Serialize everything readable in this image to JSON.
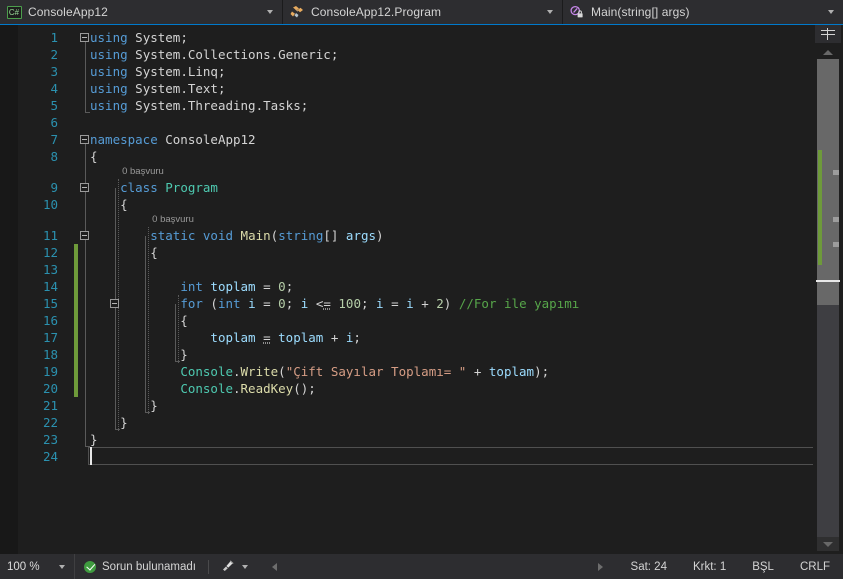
{
  "navbar": {
    "project": {
      "label": "ConsoleApp12",
      "icon": "csharp-file-icon"
    },
    "type": {
      "label": "ConsoleApp12.Program",
      "icon": "class-icon"
    },
    "member": {
      "label": "Main(string[] args)",
      "icon": "method-private-icon"
    },
    "dropdown_icon": "chevron-down-icon"
  },
  "editor": {
    "language": "csharp",
    "codelens_text": "0 başvuru",
    "lines": [
      {
        "n": 1,
        "tokens": [
          {
            "t": "using",
            "c": "kw"
          },
          {
            "t": " ",
            "c": "plain"
          },
          {
            "t": "System",
            "c": "plain"
          },
          {
            "t": ";",
            "c": "plain"
          }
        ]
      },
      {
        "n": 2,
        "tokens": [
          {
            "t": "using",
            "c": "kw"
          },
          {
            "t": " System.Collections.Generic;",
            "c": "plain"
          }
        ]
      },
      {
        "n": 3,
        "tokens": [
          {
            "t": "using",
            "c": "kw"
          },
          {
            "t": " System.Linq;",
            "c": "plain"
          }
        ]
      },
      {
        "n": 4,
        "tokens": [
          {
            "t": "using",
            "c": "kw"
          },
          {
            "t": " System.Text;",
            "c": "plain"
          }
        ]
      },
      {
        "n": 5,
        "tokens": [
          {
            "t": "using",
            "c": "kw"
          },
          {
            "t": " System.Threading.Tasks;",
            "c": "plain"
          }
        ]
      },
      {
        "n": 6,
        "tokens": []
      },
      {
        "n": 7,
        "tokens": [
          {
            "t": "namespace",
            "c": "kw"
          },
          {
            "t": " ConsoleApp12",
            "c": "plain"
          }
        ]
      },
      {
        "n": 8,
        "tokens": [
          {
            "t": "{",
            "c": "plain"
          }
        ]
      },
      {
        "n": 9,
        "tokens": [
          {
            "t": "    ",
            "c": "plain"
          },
          {
            "t": "class",
            "c": "kw"
          },
          {
            "t": " ",
            "c": "plain"
          },
          {
            "t": "Program",
            "c": "type"
          }
        ]
      },
      {
        "n": 10,
        "tokens": [
          {
            "t": "    {",
            "c": "plain"
          }
        ]
      },
      {
        "n": 11,
        "tokens": [
          {
            "t": "        ",
            "c": "plain"
          },
          {
            "t": "static",
            "c": "kw"
          },
          {
            "t": " ",
            "c": "plain"
          },
          {
            "t": "void",
            "c": "kw"
          },
          {
            "t": " ",
            "c": "plain"
          },
          {
            "t": "Main",
            "c": "method"
          },
          {
            "t": "(",
            "c": "plain"
          },
          {
            "t": "string",
            "c": "kw"
          },
          {
            "t": "[] ",
            "c": "plain"
          },
          {
            "t": "args",
            "c": "id"
          },
          {
            "t": ")",
            "c": "plain"
          }
        ]
      },
      {
        "n": 12,
        "tokens": [
          {
            "t": "        {",
            "c": "plain"
          }
        ]
      },
      {
        "n": 13,
        "tokens": []
      },
      {
        "n": 14,
        "tokens": [
          {
            "t": "            ",
            "c": "plain"
          },
          {
            "t": "int",
            "c": "kw"
          },
          {
            "t": " ",
            "c": "plain"
          },
          {
            "t": "toplam",
            "c": "id"
          },
          {
            "t": " = ",
            "c": "plain"
          },
          {
            "t": "0",
            "c": "num"
          },
          {
            "t": ";",
            "c": "plain"
          }
        ]
      },
      {
        "n": 15,
        "tokens": [
          {
            "t": "            ",
            "c": "plain"
          },
          {
            "t": "for",
            "c": "kw"
          },
          {
            "t": " (",
            "c": "plain"
          },
          {
            "t": "int",
            "c": "kw"
          },
          {
            "t": " ",
            "c": "plain"
          },
          {
            "t": "i",
            "c": "id"
          },
          {
            "t": " = ",
            "c": "plain"
          },
          {
            "t": "0",
            "c": "num"
          },
          {
            "t": "; ",
            "c": "plain"
          },
          {
            "t": "i",
            "c": "id"
          },
          {
            "t": " <= ",
            "c": "plain"
          },
          {
            "t": "100",
            "c": "num"
          },
          {
            "t": "; ",
            "c": "plain"
          },
          {
            "t": "i",
            "c": "id"
          },
          {
            "t": " = ",
            "c": "plain"
          },
          {
            "t": "i",
            "c": "id"
          },
          {
            "t": " + ",
            "c": "plain"
          },
          {
            "t": "2",
            "c": "num"
          },
          {
            "t": ") ",
            "c": "plain"
          },
          {
            "t": "//For ile yapımı",
            "c": "cmt"
          }
        ]
      },
      {
        "n": 16,
        "tokens": [
          {
            "t": "            {",
            "c": "plain"
          }
        ]
      },
      {
        "n": 17,
        "tokens": [
          {
            "t": "                ",
            "c": "plain"
          },
          {
            "t": "toplam",
            "c": "id"
          },
          {
            "t": " = ",
            "c": "plain"
          },
          {
            "t": "toplam",
            "c": "id"
          },
          {
            "t": " + ",
            "c": "plain"
          },
          {
            "t": "i",
            "c": "id"
          },
          {
            "t": ";",
            "c": "plain"
          }
        ]
      },
      {
        "n": 18,
        "tokens": [
          {
            "t": "            }",
            "c": "plain"
          }
        ]
      },
      {
        "n": 19,
        "tokens": [
          {
            "t": "            ",
            "c": "plain"
          },
          {
            "t": "Console",
            "c": "type"
          },
          {
            "t": ".",
            "c": "plain"
          },
          {
            "t": "Write",
            "c": "method"
          },
          {
            "t": "(",
            "c": "plain"
          },
          {
            "t": "\"Çift Sayılar Toplamı= \"",
            "c": "str"
          },
          {
            "t": " + ",
            "c": "plain"
          },
          {
            "t": "toplam",
            "c": "id"
          },
          {
            "t": ");",
            "c": "plain"
          }
        ]
      },
      {
        "n": 20,
        "tokens": [
          {
            "t": "            ",
            "c": "plain"
          },
          {
            "t": "Console",
            "c": "type"
          },
          {
            "t": ".",
            "c": "plain"
          },
          {
            "t": "ReadKey",
            "c": "method"
          },
          {
            "t": "();",
            "c": "plain"
          }
        ]
      },
      {
        "n": 21,
        "tokens": [
          {
            "t": "        }",
            "c": "plain"
          }
        ]
      },
      {
        "n": 22,
        "tokens": [
          {
            "t": "    }",
            "c": "plain"
          }
        ]
      },
      {
        "n": 23,
        "tokens": [
          {
            "t": "}",
            "c": "plain"
          }
        ]
      },
      {
        "n": 24,
        "tokens": []
      }
    ],
    "codelens_rows": [
      {
        "line": 9,
        "label": "0 başvuru",
        "indent": 4
      },
      {
        "line": 11,
        "label": "0 başvuru",
        "indent": 8
      }
    ]
  },
  "scrollbar": {
    "up_icon": "scroll-up-arrow-icon",
    "down_icon": "scroll-down-arrow-icon",
    "splitter_icon": "split-view-icon"
  },
  "statusbar": {
    "zoom": "100 %",
    "zoom_caret_icon": "chevron-down-icon",
    "status_text": "Sorun bulunamadı",
    "status_icon": "success-check-icon",
    "brush_icon": "source-control-icon",
    "brush_caret_icon": "chevron-down-icon",
    "prev_icon": "triangle-left-icon",
    "next_icon": "triangle-right-icon",
    "line_label": "Sat: 24",
    "col_label": "Krkt: 1",
    "insert_mode": "BŞL",
    "line_ending": "CRLF"
  },
  "colors": {
    "accent": "#007acc",
    "editor_bg": "#1e1e1e",
    "chrome_bg": "#2d2d30",
    "line_number": "#2b91af",
    "keyword": "#569cd6",
    "type": "#4ec9b0",
    "method": "#dcdcaa",
    "string": "#d69d85",
    "number": "#b5cea8",
    "comment": "#57a64a",
    "identifier": "#9cdcfe",
    "change_bar": "#6e9a3a"
  }
}
